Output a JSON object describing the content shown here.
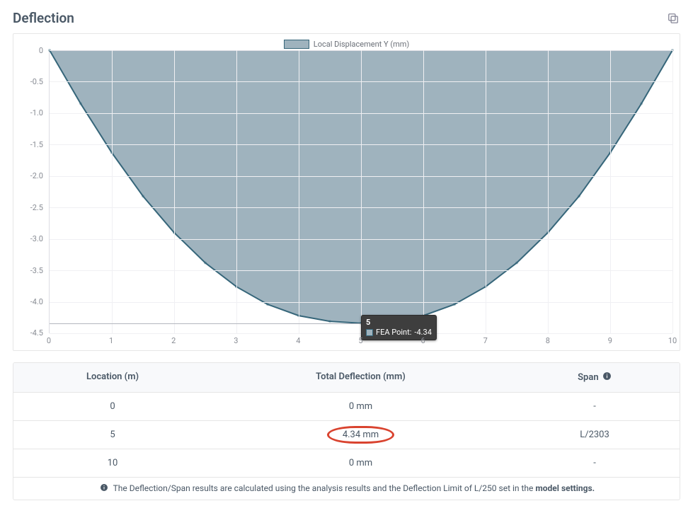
{
  "title": "Deflection",
  "chart_data": {
    "type": "area",
    "title": "",
    "legend": "Local Displacement Y (mm)",
    "xlabel": "",
    "ylabel": "",
    "xlim": [
      0,
      10
    ],
    "ylim": [
      -4.5,
      0
    ],
    "x_ticks": [
      0,
      1,
      2,
      3,
      4,
      5,
      6,
      7,
      8,
      9,
      10
    ],
    "y_ticks": [
      0,
      -0.5,
      -1.0,
      -1.5,
      -2.0,
      -2.5,
      -3.0,
      -3.5,
      -4.0,
      -4.5
    ],
    "series": [
      {
        "name": "FEA Point",
        "x": [
          0,
          0.5,
          1,
          1.5,
          2,
          2.5,
          3,
          3.5,
          4,
          4.5,
          5,
          5.5,
          6,
          6.5,
          7,
          7.5,
          8,
          8.5,
          9,
          9.5,
          10
        ],
        "y": [
          0,
          -0.85,
          -1.63,
          -2.32,
          -2.9,
          -3.38,
          -3.76,
          -4.04,
          -4.22,
          -4.31,
          -4.34,
          -4.31,
          -4.22,
          -4.04,
          -3.76,
          -3.38,
          -2.9,
          -2.32,
          -1.63,
          -0.85,
          0
        ]
      }
    ],
    "tooltip": {
      "x_label": "5",
      "series_label": "FEA Point:",
      "value": "-4.34"
    },
    "colors": {
      "fill": "#9fb3be",
      "stroke": "#36667a"
    }
  },
  "table": {
    "headers": {
      "location": "Location (m)",
      "deflection": "Total Deflection (mm)",
      "span": "Span"
    },
    "rows": [
      {
        "location": "0",
        "deflection": "0 mm",
        "span": "-",
        "highlight": false
      },
      {
        "location": "5",
        "deflection": "4.34 mm",
        "span": "L/2303",
        "highlight": true
      },
      {
        "location": "10",
        "deflection": "0 mm",
        "span": "-",
        "highlight": false
      }
    ],
    "footer_prefix": "The Deflection/Span results are calculated using the analysis results and the Deflection Limit of L/250 set in the ",
    "footer_bold": "model settings."
  }
}
